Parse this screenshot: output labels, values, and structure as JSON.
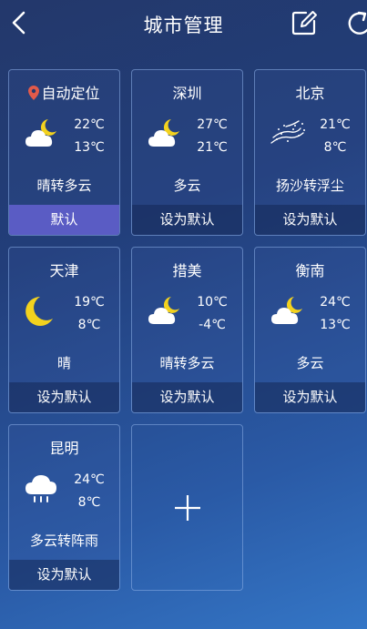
{
  "header": {
    "title": "城市管理"
  },
  "cities": [
    {
      "name": "自动定位",
      "high": "22℃",
      "low": "13℃",
      "condition": "晴转多云",
      "icon": "moon-cloud-icon",
      "button": "默认",
      "is_default": true,
      "has_location_pin": true
    },
    {
      "name": "深圳",
      "high": "27℃",
      "low": "21℃",
      "condition": "多云",
      "icon": "moon-cloud-icon",
      "button": "设为默认"
    },
    {
      "name": "北京",
      "high": "21℃",
      "low": "8℃",
      "condition": "扬沙转浮尘",
      "icon": "sand-wind-icon",
      "button": "设为默认"
    },
    {
      "name": "天津",
      "high": "19℃",
      "low": "8℃",
      "condition": "晴",
      "icon": "moon-icon",
      "button": "设为默认"
    },
    {
      "name": "措美",
      "high": "10℃",
      "low": "-4℃",
      "condition": "晴转多云",
      "icon": "moon-cloud-icon",
      "button": "设为默认"
    },
    {
      "name": "衡南",
      "high": "24℃",
      "low": "13℃",
      "condition": "多云",
      "icon": "moon-cloud-icon",
      "button": "设为默认"
    },
    {
      "name": "昆明",
      "high": "24℃",
      "low": "8℃",
      "condition": "多云转阵雨",
      "icon": "rain-cloud-icon",
      "button": "设为默认"
    }
  ],
  "colors": {
    "default_button": "#5a5cc4",
    "location_pin": "#e25a4a",
    "moon": "#f3d21e"
  }
}
